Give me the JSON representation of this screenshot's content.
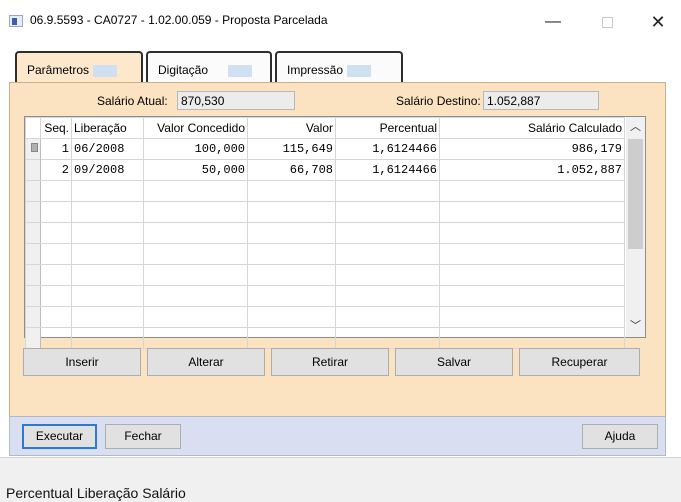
{
  "window": {
    "title": "06.9.5593 - CA0727 - 1.02.00.059 - Proposta Parcelada"
  },
  "tabs": [
    {
      "label": "Parâmetros"
    },
    {
      "label": "Digitação"
    },
    {
      "label": "Impressão"
    }
  ],
  "fields": {
    "salario_atual_label": "Salário Atual:",
    "salario_atual_value": "870,530",
    "salario_destino_label": "Salário Destino:",
    "salario_destino_value": "1.052,887"
  },
  "grid": {
    "headers": [
      "Seq.",
      "Liberação",
      "Valor Concedido",
      "Valor",
      "Percentual",
      "Salário Calculado"
    ],
    "rows": [
      {
        "seq": "1",
        "liberacao": "06/2008",
        "valor_concedido": "100,000",
        "valor": "115,649",
        "percentual": "1,6124466",
        "salario_calculado": "986,179"
      },
      {
        "seq": "2",
        "liberacao": "09/2008",
        "valor_concedido": "50,000",
        "valor": "66,708",
        "percentual": "1,6124466",
        "salario_calculado": "1.052,887"
      }
    ]
  },
  "actions": {
    "inserir": "Inserir",
    "alterar": "Alterar",
    "retirar": "Retirar",
    "salvar": "Salvar",
    "recuperar": "Recuperar"
  },
  "footer": {
    "executar": "Executar",
    "fechar": "Fechar",
    "ajuda": "Ajuda"
  },
  "status": {
    "text": "Percentual Liberação Salário"
  }
}
